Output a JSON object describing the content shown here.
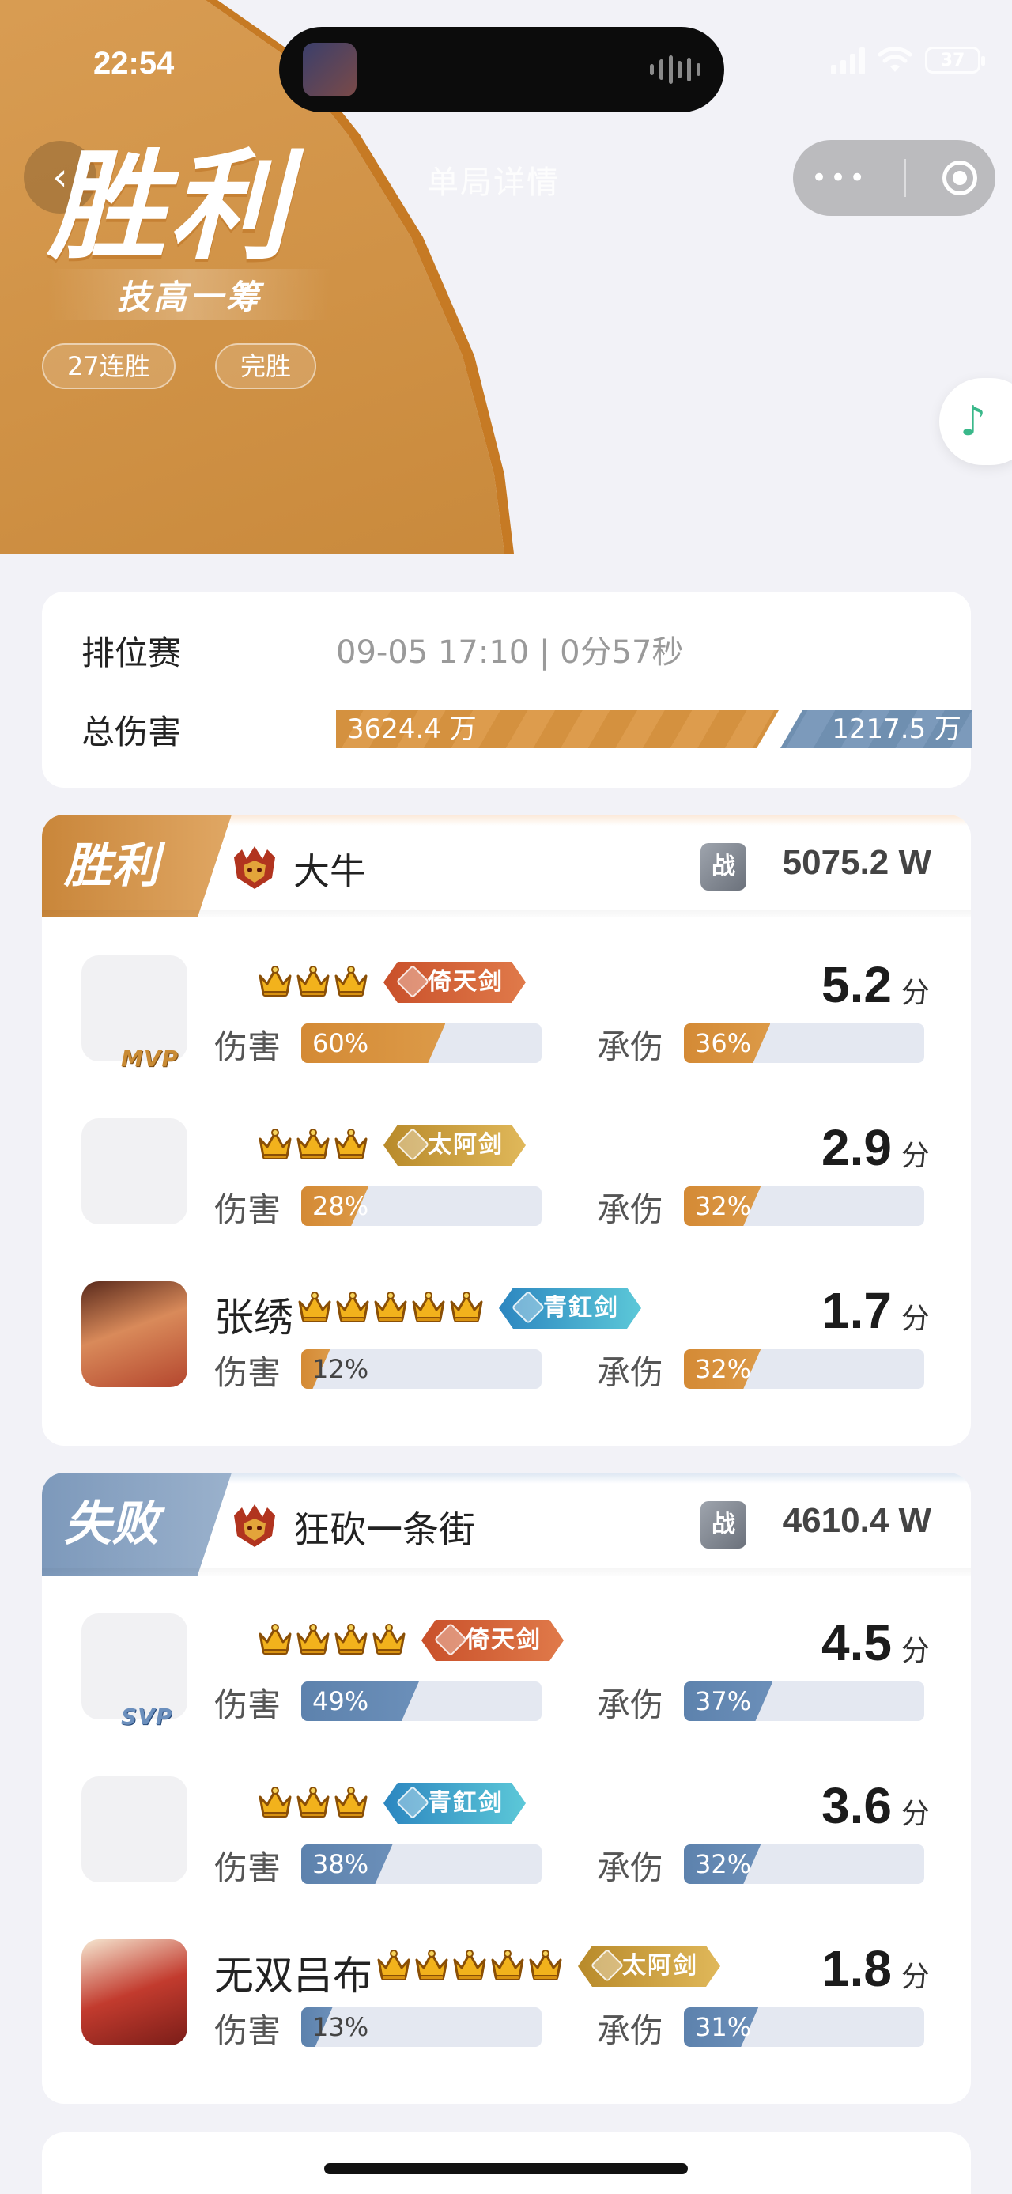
{
  "status": {
    "time": "22:54",
    "battery": "37"
  },
  "nav": {
    "title": "单局详情"
  },
  "hero": {
    "result_big": "胜利",
    "subtitle": "技高一筹",
    "tags": [
      "27连胜",
      "完胜"
    ]
  },
  "summary": {
    "mode": "排位赛",
    "meta": "09-05 17:10 | 0分57秒",
    "damage_label": "总伤害",
    "our_damage": "3624.4 万",
    "enemy_damage": "1217.5 万"
  },
  "team_a": {
    "result": "胜利",
    "name": "大牛",
    "power": "5075.2 W",
    "players": [
      {
        "name": "",
        "badge": "MVP",
        "stars": 3,
        "weapon": "倚天剑",
        "weapon_color": "red",
        "score": "5.2",
        "unit": "分",
        "damage_label": "伤害",
        "damage": "60%",
        "damage_pct": 60,
        "taken_label": "承伤",
        "taken": "36%",
        "taken_pct": 36
      },
      {
        "name": "",
        "badge": "",
        "stars": 3,
        "weapon": "太阿剑",
        "weapon_color": "gold",
        "score": "2.9",
        "unit": "分",
        "damage_label": "伤害",
        "damage": "28%",
        "damage_pct": 28,
        "taken_label": "承伤",
        "taken": "32%",
        "taken_pct": 32
      },
      {
        "name": "张绣",
        "badge": "",
        "stars": 5,
        "weapon": "青釭剑",
        "weapon_color": "cyan",
        "score": "1.7",
        "unit": "分",
        "damage_label": "伤害",
        "damage": "12%",
        "damage_pct": 12,
        "taken_label": "承伤",
        "taken": "32%",
        "taken_pct": 32
      }
    ]
  },
  "team_b": {
    "result": "失败",
    "name": "狂砍一条街",
    "power": "4610.4 W",
    "players": [
      {
        "name": "",
        "badge": "SVP",
        "stars": 4,
        "weapon": "倚天剑",
        "weapon_color": "red",
        "score": "4.5",
        "unit": "分",
        "damage_label": "伤害",
        "damage": "49%",
        "damage_pct": 49,
        "taken_label": "承伤",
        "taken": "37%",
        "taken_pct": 37
      },
      {
        "name": "",
        "badge": "",
        "stars": 3,
        "weapon": "青釭剑",
        "weapon_color": "cyan",
        "score": "3.6",
        "unit": "分",
        "damage_label": "伤害",
        "damage": "38%",
        "damage_pct": 38,
        "taken_label": "承伤",
        "taken": "32%",
        "taken_pct": 32
      },
      {
        "name": "无双吕布",
        "badge": "",
        "stars": 5,
        "weapon": "太阿剑",
        "weapon_color": "gold",
        "score": "1.8",
        "unit": "分",
        "damage_label": "伤害",
        "damage": "13%",
        "damage_pct": 13,
        "taken_label": "承伤",
        "taken": "31%",
        "taken_pct": 31
      }
    ]
  },
  "power_icon_text": "战",
  "colors": {
    "win": "#d4913f",
    "lose": "#6f8fb0",
    "background": "#f2f2f7"
  },
  "icons": {
    "back": "chevron-left-icon",
    "more": "more-dots-icon",
    "close": "target-icon",
    "music": "music-note-icon"
  }
}
